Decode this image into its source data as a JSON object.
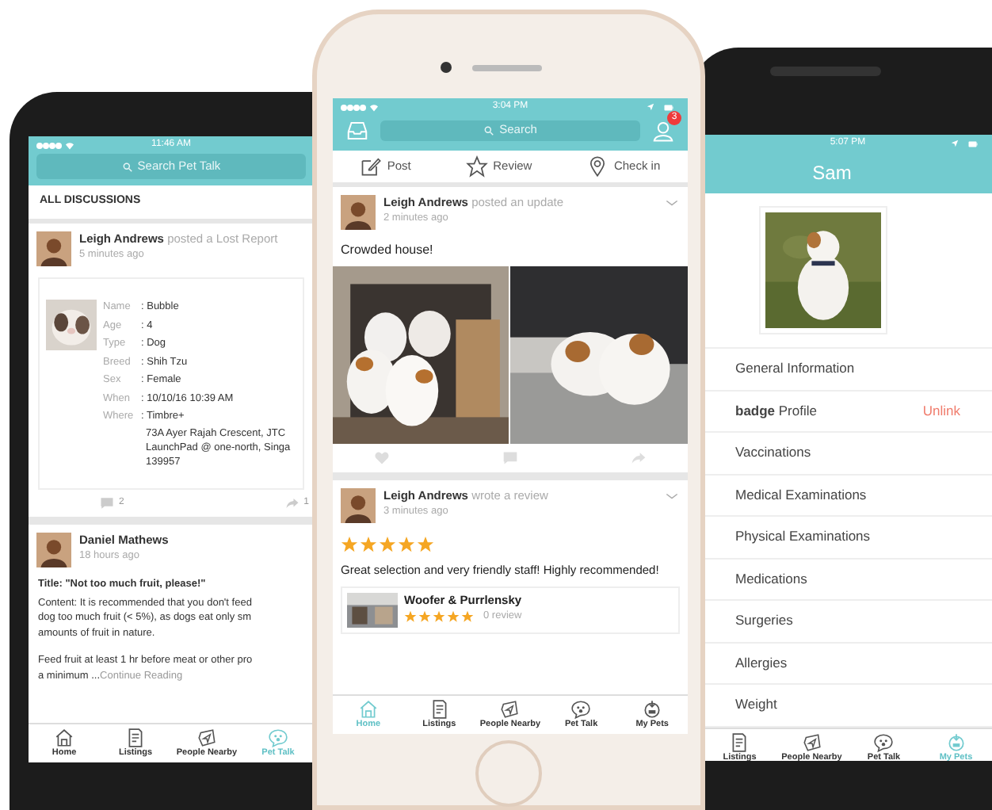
{
  "left_phone": {
    "status_time": "11:46 AM",
    "search_placeholder": "Search Pet Talk",
    "section_title": "ALL DISCUSSIONS",
    "lost_post": {
      "author": "Leigh Andrews",
      "action": "posted a Lost Report",
      "time": "5 minutes ago",
      "details": [
        {
          "label": "Name",
          "value": ": Bubble"
        },
        {
          "label": "Age",
          "value": ": 4"
        },
        {
          "label": "Type",
          "value": ": Dog"
        },
        {
          "label": "Breed",
          "value": ": Shih Tzu"
        },
        {
          "label": "Sex",
          "value": ": Female"
        },
        {
          "label": "When",
          "value": ": 10/10/16 10:39 AM"
        },
        {
          "label": "Where",
          "value": ": Timbre+",
          "more": [
            "73A Ayer Rajah Crescent, JTC",
            "LaunchPad @ one-north, Singa",
            "139957"
          ]
        }
      ],
      "comments": "2",
      "shares": "1"
    },
    "article": {
      "author": "Daniel Mathews",
      "time": "18 hours ago",
      "title": "Title: \"Not too much fruit, please!\"",
      "paragraphs": [
        [
          "Content: It is recommended that you don't feed",
          "dog too much fruit (< 5%), as dogs eat only sm",
          "amounts of fruit in nature."
        ],
        [
          "Feed fruit at least 1 hr before meat or other pro"
        ]
      ],
      "last_line": "a minimum ...",
      "more_link": "Continue Reading"
    },
    "tabs": [
      {
        "label": "Home",
        "kind": "home",
        "selected": false
      },
      {
        "label": "Listings",
        "kind": "listings",
        "selected": false
      },
      {
        "label": "People Nearby",
        "kind": "nearby",
        "selected": false
      },
      {
        "label": "Pet Talk",
        "kind": "talk",
        "selected": true
      }
    ]
  },
  "center_phone": {
    "status_time": "3:04 PM",
    "search_placeholder": "Search",
    "notification_count": "3",
    "actions": [
      {
        "label": "Post",
        "kind": "post"
      },
      {
        "label": "Review",
        "kind": "review"
      },
      {
        "label": "Check in",
        "kind": "checkin"
      }
    ],
    "update": {
      "author": "Leigh Andrews",
      "action": "posted an update",
      "time": "2 minutes ago",
      "text": "Crowded house!"
    },
    "review": {
      "author": "Leigh Andrews",
      "action": "wrote a review",
      "time": "3 minutes ago",
      "stars": 5,
      "text": "Great selection and very friendly staff! Highly recommended!",
      "place": {
        "name": "Woofer & Purrlensky",
        "stars": 5,
        "reviews": "0 review"
      }
    },
    "tabs": [
      {
        "label": "Home",
        "kind": "home",
        "selected": true
      },
      {
        "label": "Listings",
        "kind": "listings",
        "selected": false
      },
      {
        "label": "People Nearby",
        "kind": "nearby",
        "selected": false
      },
      {
        "label": "Pet Talk",
        "kind": "talk",
        "selected": false
      },
      {
        "label": "My Pets",
        "kind": "pets",
        "selected": false
      }
    ]
  },
  "right_phone": {
    "status_time": "5:07 PM",
    "title": "Sam",
    "menu": [
      {
        "label": "General Information"
      },
      {
        "label": "**badge** Profile",
        "action": "Unlink"
      },
      {
        "label": "Vaccinations"
      },
      {
        "label": "Medical Examinations"
      },
      {
        "label": "Physical Examinations"
      },
      {
        "label": "Medications"
      },
      {
        "label": "Surgeries"
      },
      {
        "label": "Allergies"
      },
      {
        "label": "Weight"
      }
    ],
    "tabs": [
      {
        "label": "Listings",
        "kind": "listings",
        "selected": false
      },
      {
        "label": "People Nearby",
        "kind": "nearby",
        "selected": false
      },
      {
        "label": "Pet Talk",
        "kind": "talk",
        "selected": false
      },
      {
        "label": "My Pets",
        "kind": "pets",
        "selected": true
      }
    ]
  }
}
